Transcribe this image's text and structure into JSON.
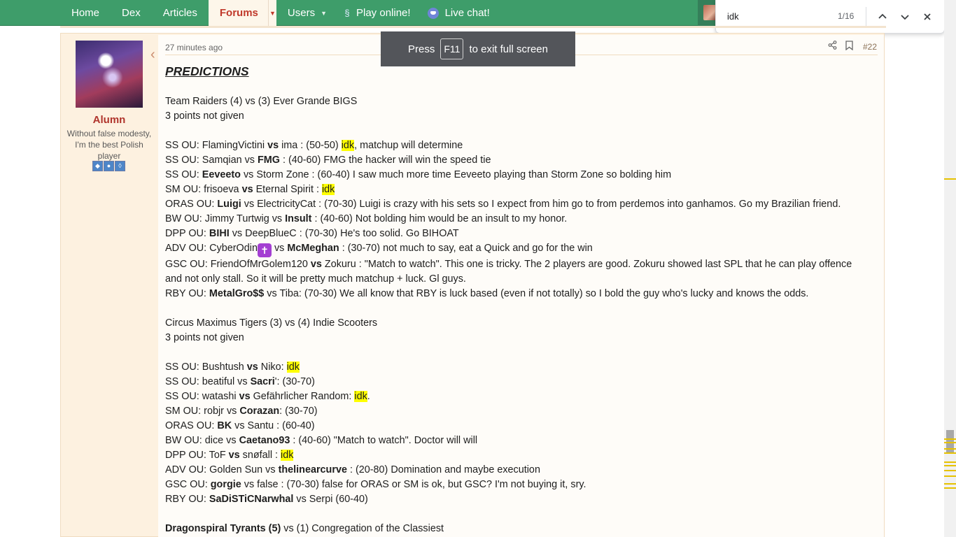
{
  "nav": {
    "items": [
      "Home",
      "Dex",
      "Articles",
      "Forums",
      "Users",
      "Play online!",
      "Live chat!"
    ],
    "colors": {
      "bar": "#3e9d6a",
      "active_bg": "#fdf6ea",
      "active_text": "#c0392b"
    }
  },
  "findbar": {
    "query": "idk",
    "count": "1/16"
  },
  "toast": {
    "before": "Press",
    "key": "F11",
    "after": "to exit full screen"
  },
  "user": {
    "name": "Alumn",
    "title": "Without false modesty, I'm the best Polish player"
  },
  "post": {
    "time": "27 minutes ago",
    "number": "#22"
  },
  "content": {
    "heading": "PREDICTIONS",
    "match1": {
      "title": "Team Raiders (4) vs (3) Ever Grande BIGS",
      "points": "3 points not given"
    },
    "match2": {
      "title": "Circus Maximus Tigers (3) vs (4) Indie Scooters",
      "points": "3 points not given"
    },
    "match3": {
      "bold": "Dragonspiral Tyrants (5)",
      "rest": " vs (1) Congregation of the Classiest"
    }
  }
}
